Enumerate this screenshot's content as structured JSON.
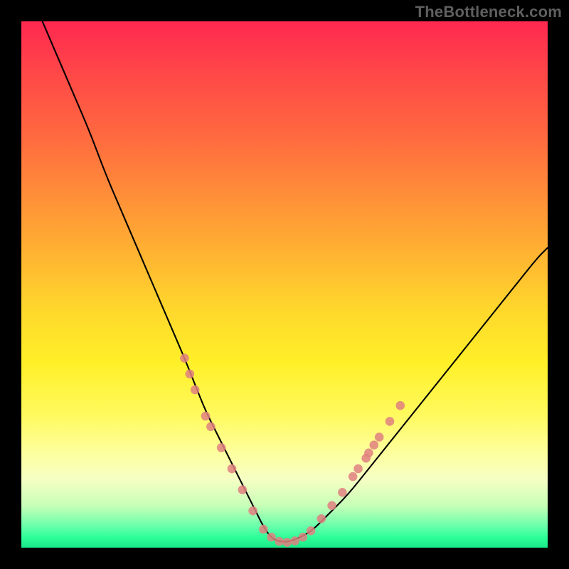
{
  "watermark": "TheBottleneck.com",
  "chart_data": {
    "type": "line",
    "title": "",
    "xlabel": "",
    "ylabel": "",
    "xlim": [
      0,
      100
    ],
    "ylim": [
      0,
      100
    ],
    "grid": false,
    "legend": false,
    "series": [
      {
        "name": "bottleneck-curve",
        "color": "#000000",
        "x": [
          4,
          7,
          10,
          13,
          16,
          19,
          22,
          25,
          28,
          31,
          33,
          35,
          37,
          39,
          41,
          43,
          45,
          46,
          47,
          48,
          50,
          52,
          55,
          58,
          62,
          66,
          70,
          74,
          78,
          82,
          86,
          90,
          94,
          98,
          100
        ],
        "y": [
          100,
          93,
          86,
          79,
          71,
          64,
          57,
          50,
          43,
          36,
          31,
          26,
          22,
          18,
          14,
          10,
          6,
          4,
          2.5,
          1.5,
          1,
          1.5,
          3,
          6,
          10,
          15,
          20,
          25,
          30,
          35,
          40,
          45,
          50,
          55,
          57
        ]
      }
    ],
    "markers": {
      "name": "sample-points",
      "color": "#e08080",
      "radius_frac": 0.0085,
      "points": [
        {
          "x": 31,
          "y": 36
        },
        {
          "x": 32,
          "y": 33
        },
        {
          "x": 33,
          "y": 30
        },
        {
          "x": 35,
          "y": 25
        },
        {
          "x": 36,
          "y": 23
        },
        {
          "x": 38,
          "y": 19
        },
        {
          "x": 40,
          "y": 15
        },
        {
          "x": 42,
          "y": 11
        },
        {
          "x": 44,
          "y": 7
        },
        {
          "x": 46,
          "y": 3.5
        },
        {
          "x": 47.5,
          "y": 2
        },
        {
          "x": 49,
          "y": 1.2
        },
        {
          "x": 50.5,
          "y": 1
        },
        {
          "x": 52,
          "y": 1.3
        },
        {
          "x": 53.5,
          "y": 2
        },
        {
          "x": 55,
          "y": 3.2
        },
        {
          "x": 57,
          "y": 5.5
        },
        {
          "x": 59,
          "y": 8
        },
        {
          "x": 61,
          "y": 10.5
        },
        {
          "x": 63,
          "y": 13.5
        },
        {
          "x": 64,
          "y": 15
        },
        {
          "x": 65.5,
          "y": 17
        },
        {
          "x": 66,
          "y": 18
        },
        {
          "x": 67,
          "y": 19.5
        },
        {
          "x": 68,
          "y": 21
        },
        {
          "x": 70,
          "y": 24
        },
        {
          "x": 72,
          "y": 27
        }
      ]
    }
  }
}
